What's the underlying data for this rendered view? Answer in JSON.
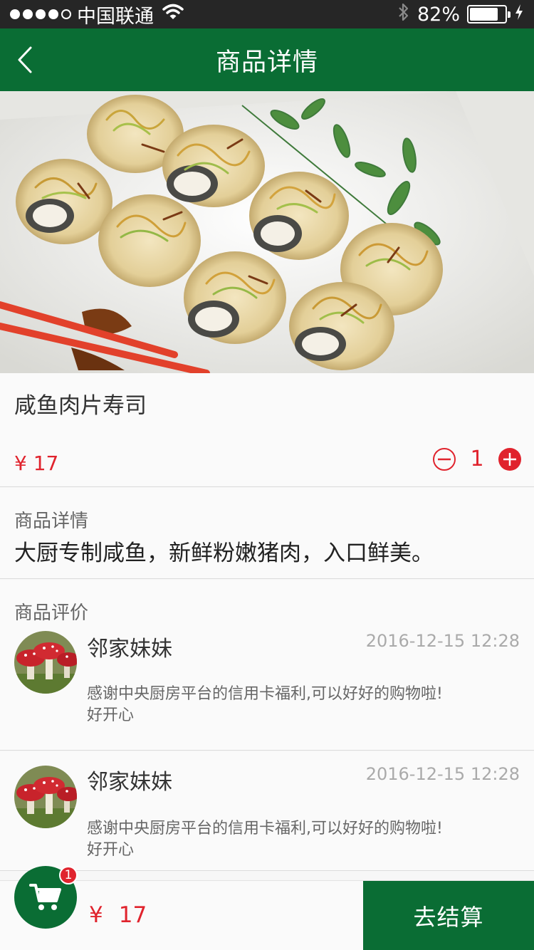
{
  "status_bar": {
    "carrier": "中国联通",
    "battery": "82%",
    "battery_level": 0.82,
    "icons": [
      "signal-dots-icon",
      "wifi-icon",
      "bluetooth-icon",
      "battery-icon",
      "charging-icon"
    ]
  },
  "nav": {
    "title": "商品详情",
    "back_icon": "chevron-left-icon"
  },
  "product": {
    "image_alt": "sushi-rolls-photo",
    "name": "咸鱼肉片寿司",
    "price": "¥ 17",
    "quantity": "1"
  },
  "detail": {
    "title": "商品详情",
    "text": "大厨专制咸鱼，新鲜粉嫩猪肉，入口鲜美。"
  },
  "reviews": {
    "title": "商品评价",
    "items": [
      {
        "name": "邻家妹妹",
        "date": "2016-12-15  12:28",
        "text_line1": "感谢中央厨房平台的信用卡福利,可以好好的购物啦!",
        "text_line2": "好开心"
      },
      {
        "name": "邻家妹妹",
        "date": "2016-12-15  12:28",
        "text_line1": "感谢中央厨房平台的信用卡福利,可以好好的购物啦!",
        "text_line2": "好开心"
      }
    ]
  },
  "bottom": {
    "currency": "¥",
    "total": "17",
    "cart_count": "1",
    "checkout_label": "去结算"
  },
  "colors": {
    "brand_green": "#0a6d34",
    "accent_red": "#e0232d"
  }
}
